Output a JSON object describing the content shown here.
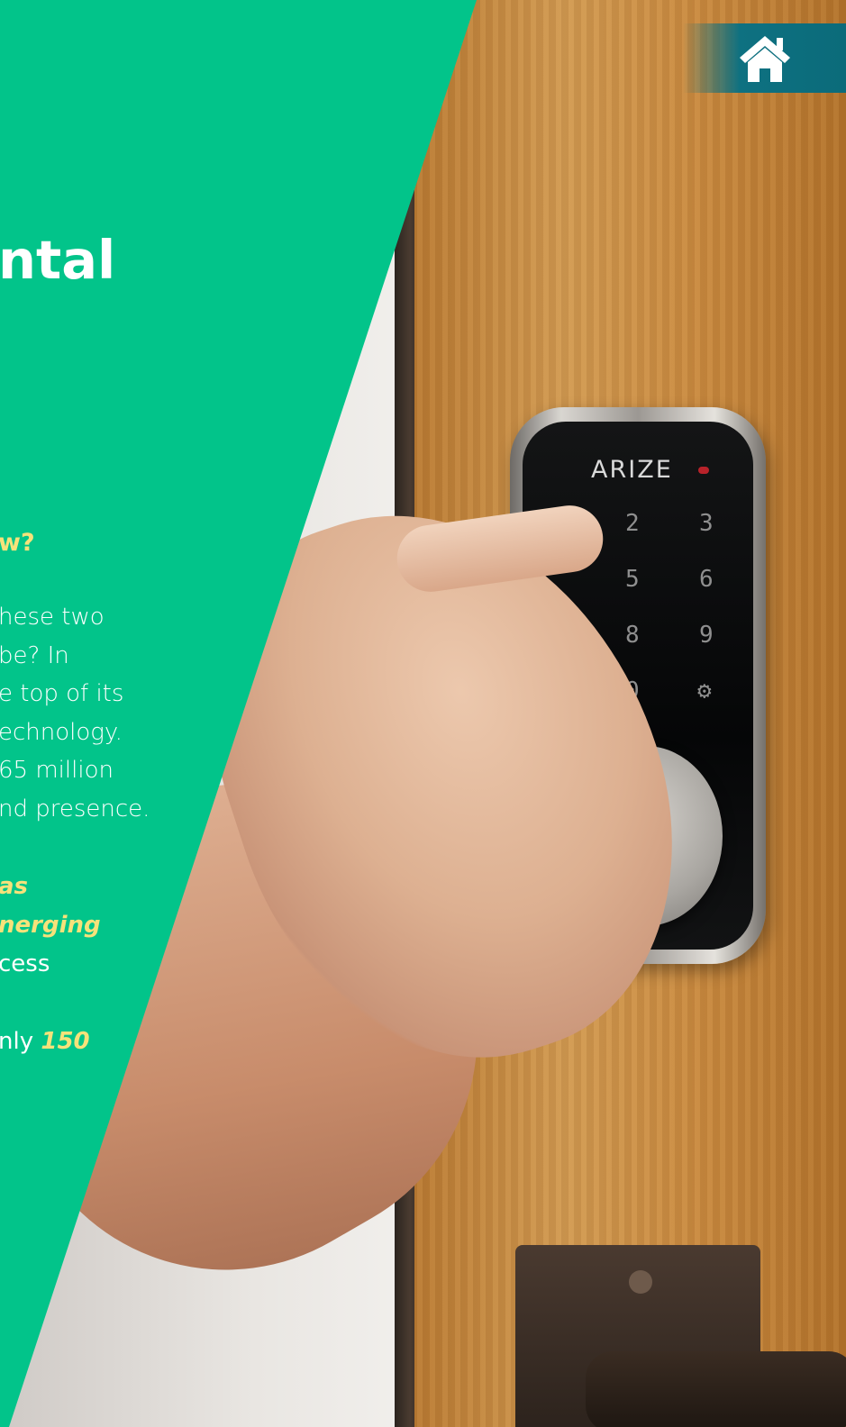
{
  "header": {
    "home_button_icon": "home-icon",
    "accent_color": "#0e7181"
  },
  "panel": {
    "color": "#02c48a",
    "heading": "ntal",
    "subheading": "w?",
    "paragraph_lines": [
      "hese two",
      " be? In",
      "e top of its",
      "echnology.",
      "65 million",
      "nd presence."
    ],
    "highlight_lines": [
      {
        "plain": "",
        "emphasis": "as"
      },
      {
        "plain": "",
        "emphasis": "nerging"
      },
      {
        "plain": "cess",
        "emphasis": ""
      },
      {
        "plain": "",
        "emphasis": ""
      },
      {
        "plain": "nly ",
        "emphasis": "150"
      }
    ],
    "highlight_color": "#f6e27a"
  },
  "photo": {
    "keypad_brand": "ARIZE",
    "keypad_keys": [
      "2",
      "3",
      "5",
      "6",
      "8",
      "9",
      "0"
    ]
  }
}
